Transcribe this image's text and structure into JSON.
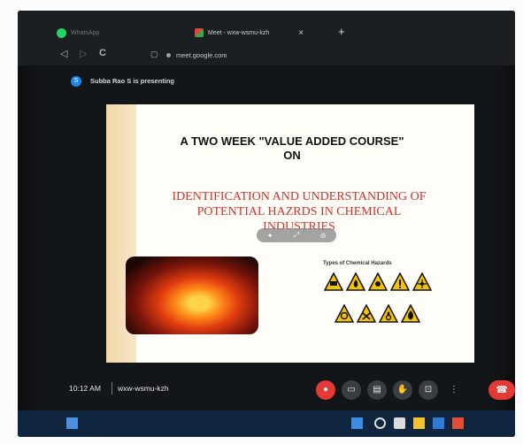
{
  "browser": {
    "tabs": [
      {
        "label": "WhatsApp",
        "icon": "whatsapp-icon"
      },
      {
        "label": "Meet - wxw-wsmu-kzh",
        "icon": "meet-icon"
      }
    ],
    "close_glyph": "×",
    "new_tab_glyph": "+",
    "back_glyph": "◁",
    "forward_glyph": "▷",
    "reload_glyph": "C",
    "address": "meet.google.com"
  },
  "meet": {
    "presenter_initial": "S",
    "presenting_text": "Subba Rao S is presenting",
    "time": "10:12 AM",
    "meeting_code": "wxw-wsmu-kzh",
    "end_call_glyph": "☎"
  },
  "slide": {
    "heading_line1": "A TWO WEEK \"VALUE ADDED COURSE\"",
    "heading_line2": "ON",
    "title_line1": "IDENTIFICATION AND UNDERSTANDING OF",
    "title_line2": "POTENTIAL HAZRDS IN CHEMICAL",
    "title_line3": "INDUSTRIES",
    "hazards_title": "Types of Chemical Hazards"
  },
  "colors": {
    "accent_red": "#d2312a",
    "meet_red": "#e53935",
    "taskbar": "#10263f"
  }
}
